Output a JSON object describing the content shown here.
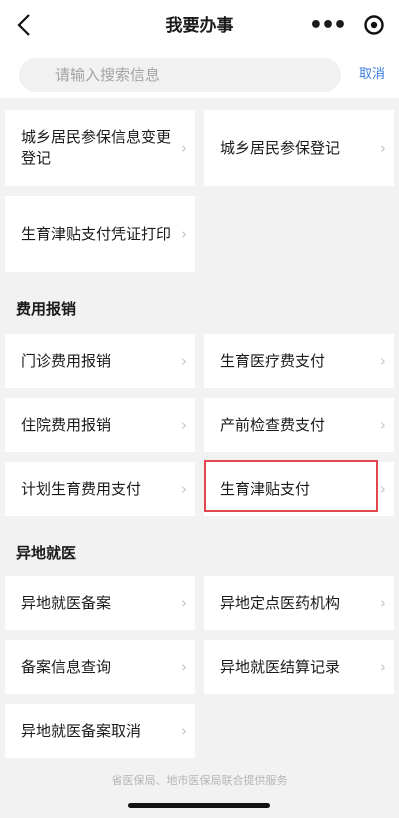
{
  "header": {
    "title": "我要办事",
    "more_glyph": "•••"
  },
  "search": {
    "placeholder": "请输入搜索信息",
    "cancel_label": "取消"
  },
  "top_items": [
    {
      "label": "城乡居民参保信息变更登记"
    },
    {
      "label": "城乡居民参保登记"
    },
    {
      "label": "生育津贴支付凭证打印"
    }
  ],
  "sections": [
    {
      "title": "费用报销",
      "items": [
        {
          "label": "门诊费用报销"
        },
        {
          "label": "生育医疗费支付"
        },
        {
          "label": "住院费用报销"
        },
        {
          "label": "产前检查费支付"
        },
        {
          "label": "计划生育费用支付"
        },
        {
          "label": "生育津贴支付"
        }
      ]
    },
    {
      "title": "异地就医",
      "items": [
        {
          "label": "异地就医备案"
        },
        {
          "label": "异地定点医药机构"
        },
        {
          "label": "备案信息查询"
        },
        {
          "label": "异地就医结算记录"
        },
        {
          "label": "异地就医备案取消"
        }
      ]
    }
  ],
  "chevron": "›",
  "highlight_color": "#e2474f",
  "footer": "省医保局、地市医保局联合提供服务"
}
